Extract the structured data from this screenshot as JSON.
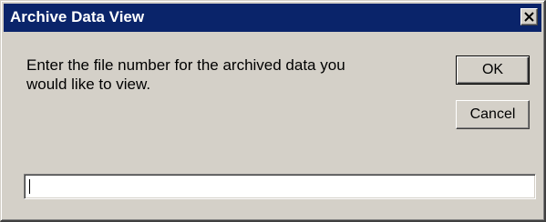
{
  "window": {
    "title": "Archive Data View",
    "close_icon": "close-x-icon"
  },
  "prompt": {
    "line1": "Enter the file number for the archived data you",
    "line2": "would like to view."
  },
  "buttons": {
    "ok_label": "OK",
    "cancel_label": "Cancel"
  },
  "input": {
    "value": ""
  },
  "colors": {
    "titlebar": "#0a246a",
    "dialog_face": "#d4d0c8",
    "input_background": "#ffffff"
  }
}
